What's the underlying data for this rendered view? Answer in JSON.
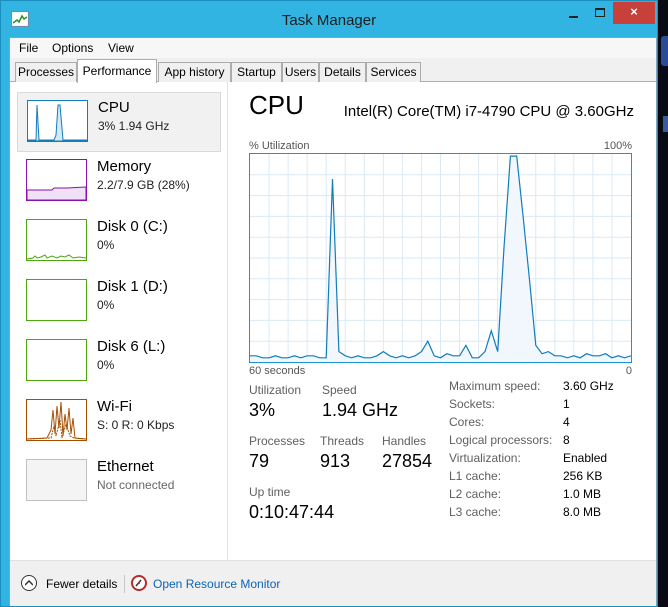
{
  "window": {
    "title": "Task Manager",
    "minimize_glyph": "minimize-icon",
    "maximize_glyph": "maximize-icon",
    "close_glyph": "×"
  },
  "menu": {
    "items": [
      "File",
      "Options",
      "View"
    ]
  },
  "tabs": [
    {
      "label": "Processes",
      "active": false
    },
    {
      "label": "Performance",
      "active": true
    },
    {
      "label": "App history",
      "active": false
    },
    {
      "label": "Startup",
      "active": false
    },
    {
      "label": "Users",
      "active": false
    },
    {
      "label": "Details",
      "active": false
    },
    {
      "label": "Services",
      "active": false
    }
  ],
  "sidebar": {
    "items": [
      {
        "name": "CPU",
        "sub": "3% 1.94 GHz",
        "color": "#117dbb",
        "selected": true
      },
      {
        "name": "Memory",
        "sub": "2.2/7.9 GB (28%)",
        "color": "#8b12ae",
        "selected": false
      },
      {
        "name": "Disk 0 (C:)",
        "sub": "0%",
        "color": "#4da60c",
        "selected": false
      },
      {
        "name": "Disk 1 (D:)",
        "sub": "0%",
        "color": "#4da60c",
        "selected": false
      },
      {
        "name": "Disk 6 (L:)",
        "sub": "0%",
        "color": "#4da60c",
        "selected": false
      },
      {
        "name": "Wi-Fi",
        "sub": "S: 0 R: 0 Kbps",
        "color": "#a74f01",
        "selected": false
      },
      {
        "name": "Ethernet",
        "sub": "Not connected",
        "color": "#c0c0c0",
        "selected": false
      }
    ]
  },
  "main": {
    "title": "CPU",
    "model": "Intel(R) Core(TM) i7-4790 CPU @ 3.60GHz",
    "graph": {
      "top_left": "% Utilization",
      "top_right": "100%",
      "bottom_left": "60 seconds",
      "bottom_right": "0"
    },
    "stats": {
      "utilization_label": "Utilization",
      "utilization": "3%",
      "speed_label": "Speed",
      "speed": "1.94 GHz",
      "processes_label": "Processes",
      "processes": "79",
      "threads_label": "Threads",
      "threads": "913",
      "handles_label": "Handles",
      "handles": "27854",
      "uptime_label": "Up time",
      "uptime": "0:10:47:44"
    },
    "info": [
      {
        "label": "Maximum speed:",
        "value": "3.60 GHz"
      },
      {
        "label": "Sockets:",
        "value": "1"
      },
      {
        "label": "Cores:",
        "value": "4"
      },
      {
        "label": "Logical processors:",
        "value": "8"
      },
      {
        "label": "Virtualization:",
        "value": "Enabled"
      },
      {
        "label": "L1 cache:",
        "value": "256 KB"
      },
      {
        "label": "L2 cache:",
        "value": "1.0 MB"
      },
      {
        "label": "L3 cache:",
        "value": "8.0 MB"
      }
    ]
  },
  "footer": {
    "fewer_details": "Fewer details",
    "resource_monitor": "Open Resource Monitor"
  },
  "chart_data": {
    "type": "area",
    "title": "",
    "xlabel": "",
    "ylabel": "% Utilization",
    "xlim": [
      60,
      0
    ],
    "ylim": [
      0,
      100
    ],
    "x": [
      60,
      59,
      58,
      57,
      56,
      55,
      54,
      53,
      52,
      51,
      50,
      49,
      48,
      47,
      46,
      45,
      44,
      43,
      42,
      41,
      40,
      39,
      38,
      37,
      36,
      35,
      34,
      33,
      32,
      31,
      30,
      29,
      28,
      27,
      26,
      25,
      24,
      23,
      22,
      21,
      20,
      19,
      18,
      17,
      16,
      15,
      14,
      13,
      12,
      11,
      10,
      9,
      8,
      7,
      6,
      5,
      4,
      3,
      2,
      1,
      0
    ],
    "series": [
      {
        "values": [
          3,
          3,
          2,
          2,
          3,
          2,
          2,
          3,
          2,
          3,
          3,
          2,
          2,
          88,
          5,
          3,
          2,
          3,
          2,
          2,
          3,
          5,
          3,
          2,
          3,
          2,
          3,
          5,
          10,
          3,
          2,
          4,
          3,
          3,
          8,
          2,
          2,
          5,
          15,
          5,
          55,
          99,
          99,
          70,
          40,
          8,
          4,
          5,
          3,
          3,
          2,
          3,
          2,
          4,
          3,
          3,
          4,
          2,
          3,
          2,
          3
        ]
      }
    ],
    "grid": true
  }
}
